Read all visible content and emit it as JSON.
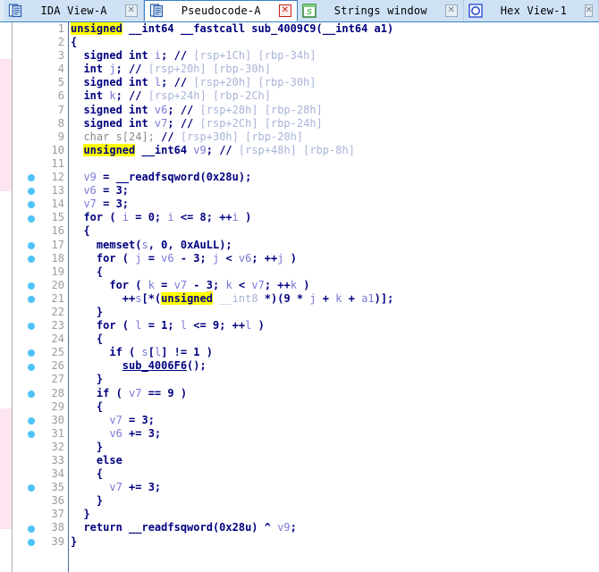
{
  "window": {
    "title": "Pseudocode-A",
    "active_tab": "Pseudocode-A"
  },
  "tabs": [
    {
      "label": "IDA View-A",
      "icon": "document-blue-icon",
      "active": false,
      "close_style": "gray"
    },
    {
      "label": "Pseudocode-A",
      "icon": "document-blue-icon",
      "active": true,
      "close_style": "red"
    },
    {
      "label": "Strings window",
      "icon": "strings-green-icon",
      "active": false,
      "close_style": "gray"
    },
    {
      "label": "Hex View-1",
      "icon": "hex-circle-icon",
      "active": false,
      "close_style": "gray-clipped"
    }
  ],
  "colors": {
    "keyword": "#000080",
    "variable": "#7a7ad6",
    "comment": "#a8b4d8",
    "unused_decl": "#8a8a8a",
    "highlight_bg": "#ffff00",
    "breakpoint_dot": "#4fc3f7",
    "tab_active_bg": "#ffffff",
    "tab_inactive_bg": "#cfe2f5",
    "tabbar_bg": "#dfe9f5",
    "gutter_rule": "#4a6a9a",
    "line_number": "#9b9b9b"
  },
  "highlighted_token": "unsigned",
  "decompiled_function": {
    "name": "sub_4009C9",
    "signature": "unsigned __int64 __fastcall sub_4009C9(__int64 a1)",
    "call_target": "sub_4006F6"
  },
  "code": {
    "line_count": 39,
    "lines": [
      {
        "n": 1,
        "bp": false,
        "text": "unsigned __int64 __fastcall sub_4009C9(__int64 a1)"
      },
      {
        "n": 2,
        "bp": false,
        "text": "{"
      },
      {
        "n": 3,
        "bp": false,
        "text": "  signed int i; // [rsp+1Ch] [rbp-34h]"
      },
      {
        "n": 4,
        "bp": false,
        "text": "  int j; // [rsp+20h] [rbp-30h]"
      },
      {
        "n": 5,
        "bp": false,
        "text": "  signed int l; // [rsp+20h] [rbp-30h]"
      },
      {
        "n": 6,
        "bp": false,
        "text": "  int k; // [rsp+24h] [rbp-2Ch]"
      },
      {
        "n": 7,
        "bp": false,
        "text": "  signed int v6; // [rsp+28h] [rbp-28h]"
      },
      {
        "n": 8,
        "bp": false,
        "text": "  signed int v7; // [rsp+2Ch] [rbp-24h]"
      },
      {
        "n": 9,
        "bp": false,
        "text": "  char s[24]; // [rsp+30h] [rbp-20h]"
      },
      {
        "n": 10,
        "bp": false,
        "text": "  unsigned __int64 v9; // [rsp+48h] [rbp-8h]"
      },
      {
        "n": 11,
        "bp": false,
        "text": ""
      },
      {
        "n": 12,
        "bp": true,
        "text": "  v9 = __readfsqword(0x28u);"
      },
      {
        "n": 13,
        "bp": true,
        "text": "  v6 = 3;"
      },
      {
        "n": 14,
        "bp": true,
        "text": "  v7 = 3;"
      },
      {
        "n": 15,
        "bp": true,
        "text": "  for ( i = 0; i <= 8; ++i )"
      },
      {
        "n": 16,
        "bp": false,
        "text": "  {"
      },
      {
        "n": 17,
        "bp": true,
        "text": "    memset(s, 0, 0xAuLL);"
      },
      {
        "n": 18,
        "bp": true,
        "text": "    for ( j = v6 - 3; j < v6; ++j )"
      },
      {
        "n": 19,
        "bp": false,
        "text": "    {"
      },
      {
        "n": 20,
        "bp": true,
        "text": "      for ( k = v7 - 3; k < v7; ++k )"
      },
      {
        "n": 21,
        "bp": true,
        "text": "        ++s[*(unsigned __int8 *)(9 * j + k + a1)];"
      },
      {
        "n": 22,
        "bp": false,
        "text": "    }"
      },
      {
        "n": 23,
        "bp": true,
        "text": "    for ( l = 1; l <= 9; ++l )"
      },
      {
        "n": 24,
        "bp": false,
        "text": "    {"
      },
      {
        "n": 25,
        "bp": true,
        "text": "      if ( s[l] != 1 )"
      },
      {
        "n": 26,
        "bp": true,
        "text": "        sub_4006F6();"
      },
      {
        "n": 27,
        "bp": false,
        "text": "    }"
      },
      {
        "n": 28,
        "bp": true,
        "text": "    if ( v7 == 9 )"
      },
      {
        "n": 29,
        "bp": false,
        "text": "    {"
      },
      {
        "n": 30,
        "bp": true,
        "text": "      v7 = 3;"
      },
      {
        "n": 31,
        "bp": true,
        "text": "      v6 += 3;"
      },
      {
        "n": 32,
        "bp": false,
        "text": "    }"
      },
      {
        "n": 33,
        "bp": false,
        "text": "    else"
      },
      {
        "n": 34,
        "bp": false,
        "text": "    {"
      },
      {
        "n": 35,
        "bp": true,
        "text": "      v7 += 3;"
      },
      {
        "n": 36,
        "bp": false,
        "text": "    }"
      },
      {
        "n": 37,
        "bp": false,
        "text": "  }"
      },
      {
        "n": 38,
        "bp": true,
        "text": "  return __readfsqword(0x28u) ^ v9;"
      },
      {
        "n": 39,
        "bp": true,
        "text": "}"
      }
    ],
    "html_lines": [
      "<span class=\"t-hl\">unsigned</span><span class=\"t-kw\"> __int64 __fastcall sub_4009C9(__int64 a1)</span>",
      "<span class=\"t-kw\">{</span>",
      "<span class=\"t-kw\">  signed int </span><span class=\"t-var\">i</span><span class=\"t-kw\">; </span><span class=\"t-cmtmark\">// </span><span class=\"t-cmt\">[rsp+1Ch] [rbp-34h]</span>",
      "<span class=\"t-kw\">  int </span><span class=\"t-var\">j</span><span class=\"t-kw\">; </span><span class=\"t-cmtmark\">// </span><span class=\"t-cmt\">[rsp+20h] [rbp-30h]</span>",
      "<span class=\"t-kw\">  signed int </span><span class=\"t-var\">l</span><span class=\"t-kw\">; </span><span class=\"t-cmtmark\">// </span><span class=\"t-cmt\">[rsp+20h] [rbp-30h]</span>",
      "<span class=\"t-kw\">  int </span><span class=\"t-var\">k</span><span class=\"t-kw\">; </span><span class=\"t-cmtmark\">// </span><span class=\"t-cmt\">[rsp+24h] [rbp-2Ch]</span>",
      "<span class=\"t-kw\">  signed int </span><span class=\"t-var\">v6</span><span class=\"t-kw\">; </span><span class=\"t-cmtmark\">// </span><span class=\"t-cmt\">[rsp+28h] [rbp-28h]</span>",
      "<span class=\"t-kw\">  signed int </span><span class=\"t-var\">v7</span><span class=\"t-kw\">; </span><span class=\"t-cmtmark\">// </span><span class=\"t-cmt\">[rsp+2Ch] [rbp-24h]</span>",
      "<span class=\"t-gray\">  char s[24]; </span><span class=\"t-cmtmark\">// </span><span class=\"t-cmt\">[rsp+30h] [rbp-20h]</span>",
      "<span class=\"t-kw\">  </span><span class=\"t-hl\">unsigned</span><span class=\"t-kw\"> __int64 </span><span class=\"t-var\">v9</span><span class=\"t-kw\">; </span><span class=\"t-cmtmark\">// </span><span class=\"t-cmt\">[rsp+48h] [rbp-8h]</span>",
      "",
      "<span class=\"t-kw\">  </span><span class=\"t-var\">v9</span><span class=\"t-kw\"> = __readfsqword(0x28u);</span>",
      "<span class=\"t-kw\">  </span><span class=\"t-var\">v6</span><span class=\"t-kw\"> = 3;</span>",
      "<span class=\"t-kw\">  </span><span class=\"t-var\">v7</span><span class=\"t-kw\"> = 3;</span>",
      "<span class=\"t-kw\">  for ( </span><span class=\"t-var\">i</span><span class=\"t-kw\"> = 0; </span><span class=\"t-var\">i</span><span class=\"t-kw\"> &lt;= 8; ++</span><span class=\"t-var\">i</span><span class=\"t-kw\"> )</span>",
      "<span class=\"t-kw\">  {</span>",
      "<span class=\"t-kw\">    memset(</span><span class=\"t-var\">s</span><span class=\"t-kw\">, 0, 0xAuLL);</span>",
      "<span class=\"t-kw\">    for ( </span><span class=\"t-var\">j</span><span class=\"t-kw\"> = </span><span class=\"t-var\">v6</span><span class=\"t-kw\"> - 3; </span><span class=\"t-var\">j</span><span class=\"t-kw\"> &lt; </span><span class=\"t-var\">v6</span><span class=\"t-kw\">; ++</span><span class=\"t-var\">j</span><span class=\"t-kw\"> )</span>",
      "<span class=\"t-kw\">    {</span>",
      "<span class=\"t-kw\">      for ( </span><span class=\"t-var\">k</span><span class=\"t-kw\"> = </span><span class=\"t-var\">v7</span><span class=\"t-kw\"> - </span><span class=\"t-kw t-uline\">3</span><span class=\"t-kw\">; </span><span class=\"t-var\">k</span><span class=\"t-kw\"> &lt; </span><span class=\"t-var\">v7</span><span class=\"t-kw\">; ++</span><span class=\"t-var\">k</span><span class=\"t-kw\"> )</span>",
      "<span class=\"t-kw\">        ++</span><span class=\"t-var\">s</span><span class=\"t-kw\">[*(</span><span class=\"t-hl\">unsigned</span><span class=\"t-cmt\"> __int8 </span><span class=\"t-kw\">*)(9 * </span><span class=\"t-var\">j</span><span class=\"t-kw\"> + </span><span class=\"t-var\">k</span><span class=\"t-kw\"> + </span><span class=\"t-var\">a1</span><span class=\"t-kw\">)];</span>",
      "<span class=\"t-kw\">    }</span>",
      "<span class=\"t-kw\">    for ( </span><span class=\"t-var\">l</span><span class=\"t-kw\"> = 1; </span><span class=\"t-var\">l</span><span class=\"t-kw\"> &lt;= 9; ++</span><span class=\"t-var\">l</span><span class=\"t-kw\"> )</span>",
      "<span class=\"t-kw\">    {</span>",
      "<span class=\"t-kw\">      if ( </span><span class=\"t-var\">s</span><span class=\"t-kw\">[</span><span class=\"t-var\">l</span><span class=\"t-kw\">] != 1 )</span>",
      "<span class=\"t-kw\">        </span><span class=\"t-func\">sub_4006F6</span><span class=\"t-kw\">();</span>",
      "<span class=\"t-kw\">    }</span>",
      "<span class=\"t-kw\">    if ( </span><span class=\"t-var\">v7</span><span class=\"t-kw\"> == 9 )</span>",
      "<span class=\"t-kw\">    {</span>",
      "<span class=\"t-kw\">      </span><span class=\"t-var\">v7</span><span class=\"t-kw\"> = 3;</span>",
      "<span class=\"t-kw\">      </span><span class=\"t-var\">v6</span><span class=\"t-kw\"> += 3;</span>",
      "<span class=\"t-kw\">    }</span>",
      "<span class=\"t-kw\">    else</span>",
      "<span class=\"t-kw\">    {</span>",
      "<span class=\"t-kw\">      </span><span class=\"t-var\">v7</span><span class=\"t-kw\"> += 3;</span>",
      "<span class=\"t-kw\">    }</span>",
      "<span class=\"t-kw\">  }</span>",
      "<span class=\"t-kw\">  return __readfsqword(0x28u) ^ </span><span class=\"t-var\">v9</span><span class=\"t-kw\">;</span>",
      "<span class=\"t-kw\">}</span>"
    ]
  },
  "left_strip": {
    "description": "sliver of underlying IDA View-A window",
    "rows": [
      {
        "shade": "plain"
      },
      {
        "shade": "plain"
      },
      {
        "shade": "plain"
      },
      {
        "shade": "pink"
      },
      {
        "shade": "pink"
      },
      {
        "shade": "pink"
      },
      {
        "shade": "pink"
      },
      {
        "shade": "pink"
      },
      {
        "shade": "pink"
      },
      {
        "shade": "pink"
      },
      {
        "shade": "pink"
      },
      {
        "shade": "pink"
      },
      {
        "shade": "pink"
      },
      {
        "shade": "pink"
      },
      {
        "shade": "plain"
      },
      {
        "shade": "plain"
      },
      {
        "shade": "plain"
      },
      {
        "shade": "plain"
      },
      {
        "shade": "plain"
      },
      {
        "shade": "plain"
      },
      {
        "shade": "plain"
      },
      {
        "shade": "plain"
      },
      {
        "shade": "plain"
      },
      {
        "shade": "plain"
      },
      {
        "shade": "plain"
      },
      {
        "shade": "plain"
      },
      {
        "shade": "plain"
      },
      {
        "shade": "plain"
      },
      {
        "shade": "plain"
      },
      {
        "shade": "plain"
      },
      {
        "shade": "plain"
      },
      {
        "shade": "plain"
      },
      {
        "shade": "pink"
      },
      {
        "shade": "pink"
      },
      {
        "shade": "pink"
      },
      {
        "shade": "pink"
      },
      {
        "shade": "pink"
      },
      {
        "shade": "pink"
      },
      {
        "shade": "pink"
      },
      {
        "shade": "pink"
      },
      {
        "shade": "pink"
      },
      {
        "shade": "pink"
      },
      {
        "shade": "plain"
      },
      {
        "shade": "plain"
      },
      {
        "shade": "plain"
      }
    ]
  }
}
